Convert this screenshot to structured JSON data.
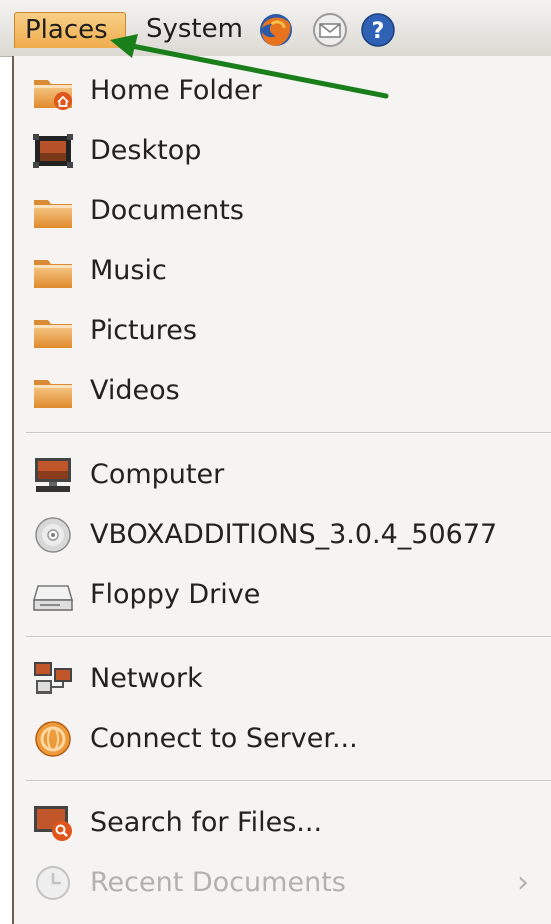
{
  "panel": {
    "places_label": "Places",
    "system_label": "System",
    "icons": [
      "firefox-icon",
      "mail-icon",
      "help-icon"
    ]
  },
  "menu": {
    "items": [
      {
        "label": "Home Folder",
        "icon": "home-folder-icon"
      },
      {
        "label": "Desktop",
        "icon": "desktop-icon"
      },
      {
        "label": "Documents",
        "icon": "folder-icon"
      },
      {
        "label": "Music",
        "icon": "folder-icon"
      },
      {
        "label": "Pictures",
        "icon": "folder-icon"
      },
      {
        "label": "Videos",
        "icon": "folder-icon"
      },
      {
        "label": "Computer",
        "icon": "computer-icon"
      },
      {
        "label": "VBOXADDITIONS_3.0.4_50677",
        "icon": "cdrom-icon"
      },
      {
        "label": "Floppy Drive",
        "icon": "floppy-icon"
      },
      {
        "label": "Network",
        "icon": "network-icon"
      },
      {
        "label": "Connect to Server...",
        "icon": "connect-server-icon"
      },
      {
        "label": "Search for Files...",
        "icon": "search-files-icon"
      },
      {
        "label": "Recent Documents",
        "icon": "recent-documents-icon",
        "disabled": true,
        "submenu_arrow": "›"
      }
    ]
  },
  "colors": {
    "places_highlight": "#f0ad4e",
    "folder_orange": "#eda24a",
    "annotation_arrow": "#1a7f1a"
  }
}
